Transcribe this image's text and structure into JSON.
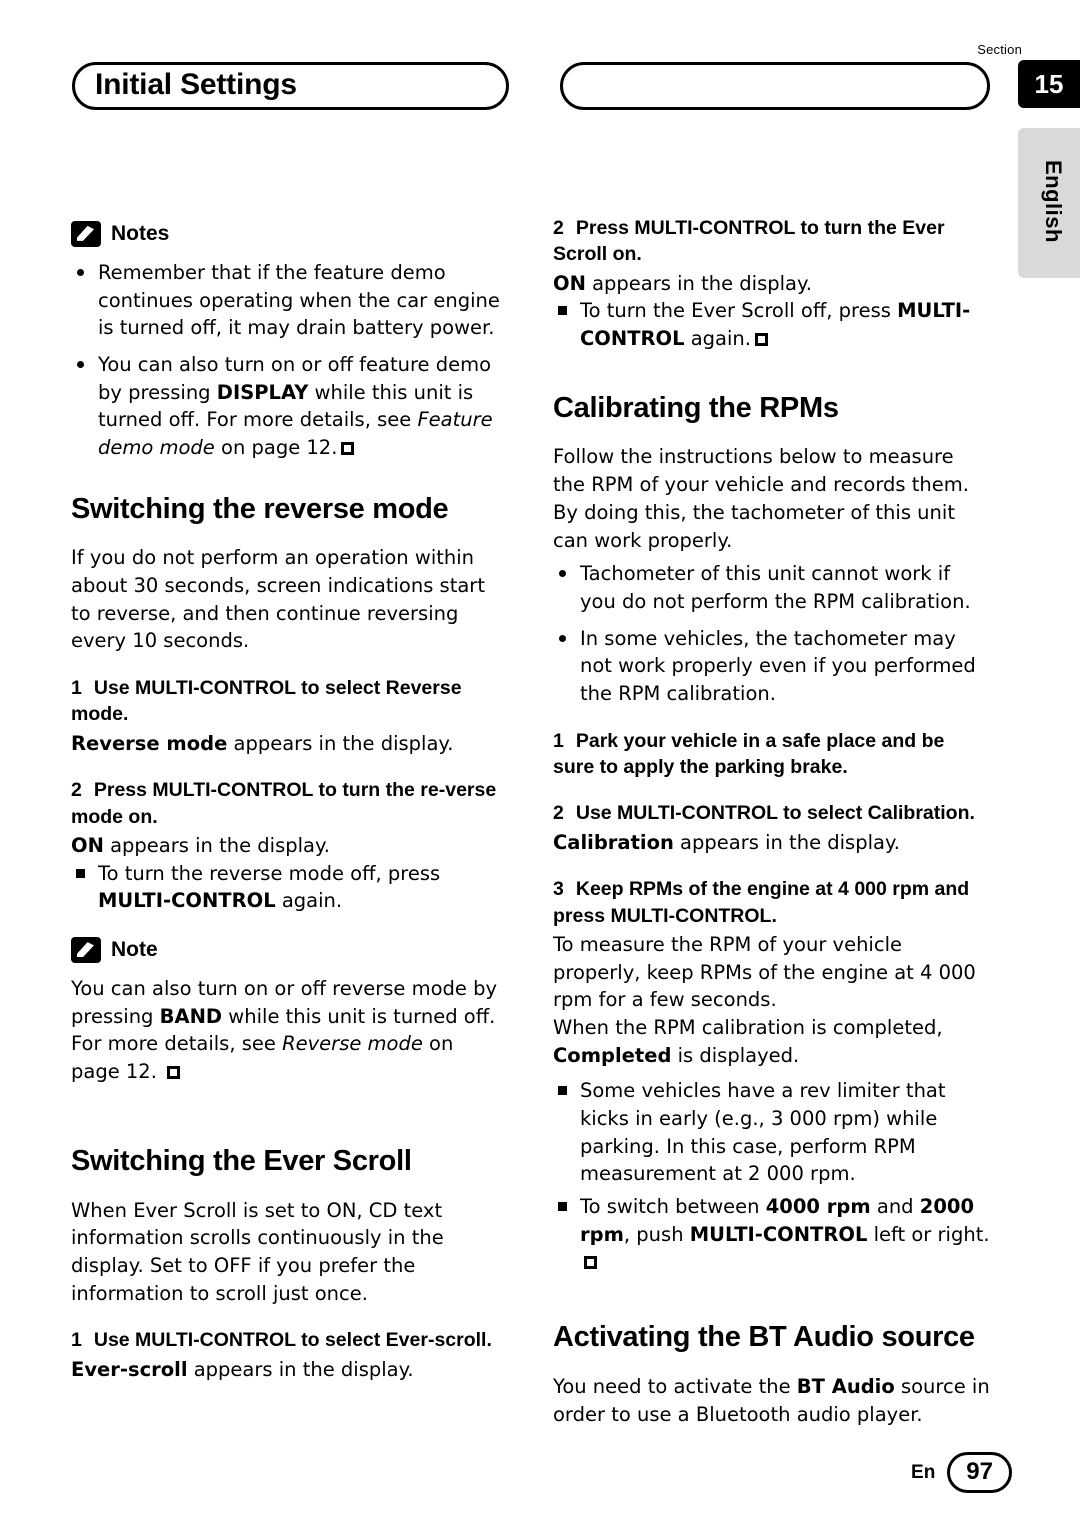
{
  "header": {
    "section_label": "Section",
    "section_number": "15",
    "page_title": "Initial Settings",
    "language_tab": "English"
  },
  "footer": {
    "en_label": "En",
    "page_number": "97"
  },
  "left_column": {
    "notes_title": "Notes",
    "notes": [
      "Remember that if the feature demo continues operating when the car engine is turned off, it may drain battery power.",
      "You can also turn on or off feature demo by pressing DISPLAY while this unit is turned off. For more details, see Feature demo mode on page 12."
    ],
    "heading_reverse": "Switching the reverse mode",
    "reverse_intro": "If you do not perform an operation within about 30 seconds, screen indications start to reverse, and then continue reversing every 10 seconds.",
    "step1_num": "1",
    "step1_text": "Use MULTI-CONTROL to select Reverse mode.",
    "step1_result_bold": "Reverse mode",
    "step1_result_rest": " appears in the display.",
    "step2_num": "2",
    "step2_text": "Press MULTI-CONTROL to turn the re-verse mode on.",
    "step2_result_bold": "ON",
    "step2_result_rest": " appears in the display.",
    "step2_sub": "To turn the reverse mode off, press MULTI-CONTROL again.",
    "note_title": "Note",
    "note_text": "You can also turn on or off reverse mode by pressing BAND while this unit is turned off. For more details, see Reverse mode on page 12.",
    "heading_ever_scroll": "Switching the Ever Scroll",
    "ever_scroll_intro": "When Ever Scroll is set to ON, CD text information scrolls continuously in the display. Set to OFF if you prefer the information to scroll just once.",
    "es_step1_num": "1",
    "es_step1_text": "Use MULTI-CONTROL to select Ever-scroll.",
    "es_step1_result_bold": "Ever-scroll",
    "es_step1_result_rest": " appears in the display."
  },
  "right_column": {
    "es_step2_num": "2",
    "es_step2_text": "Press MULTI-CONTROL to turn the Ever Scroll on.",
    "es_step2_result_bold": "ON",
    "es_step2_result_rest": " appears in the display.",
    "es_step2_sub": "To turn the Ever Scroll off, press MULTI-CONTROL again.",
    "heading_rpm": "Calibrating the RPMs",
    "rpm_intro": "Follow the instructions below to measure the RPM of your vehicle and records them. By doing this, the tachometer of this unit can work properly.",
    "rpm_bullets": [
      "Tachometer of this unit cannot work if you do not perform the RPM calibration.",
      "In some vehicles, the tachometer may not work properly even if you performed the RPM calibration."
    ],
    "rpm_step1_num": "1",
    "rpm_step1_text": "Park your vehicle in a safe place and be sure to apply the parking brake.",
    "rpm_step2_num": "2",
    "rpm_step2_text": "Use MULTI-CONTROL to select Calibration.",
    "rpm_step2_result_bold": "Calibration",
    "rpm_step2_result_rest": " appears in the display.",
    "rpm_step3_num": "3",
    "rpm_step3_text": "Keep RPMs of the engine at 4 000 rpm and press MULTI-CONTROL.",
    "rpm_step3_body": "To measure the RPM of your vehicle properly, keep RPMs of the engine at 4 000 rpm for a few seconds.",
    "rpm_step3_body2_pre": "When the RPM calibration is completed, ",
    "rpm_step3_body2_bold": "Completed",
    "rpm_step3_body2_post": " is displayed.",
    "rpm_sub1": "Some vehicles have a rev limiter that kicks in early (e.g., 3 000 rpm) while parking. In this case, perform RPM measurement at 2 000 rpm.",
    "rpm_sub2_pre": "To switch between ",
    "rpm_sub2_b1": "4000 rpm",
    "rpm_sub2_mid": " and ",
    "rpm_sub2_b2": "2000 rpm",
    "rpm_sub2_post": ", push ",
    "rpm_sub2_b3": "MULTI-CONTROL",
    "rpm_sub2_end": " left or right.",
    "heading_bt_pre": "Activating the ",
    "heading_bt_bold": "BT Audio",
    "heading_bt_post": " source",
    "bt_text_pre": "You need to activate the ",
    "bt_text_bold": "BT Audio",
    "bt_text_post": " source in order to use a Bluetooth audio player."
  }
}
